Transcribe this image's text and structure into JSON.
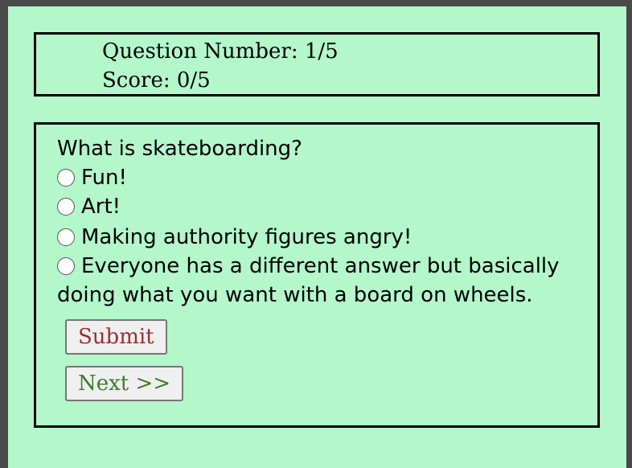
{
  "scoreboard": {
    "question_number": "Question Number: 1/5",
    "score": "Score: 0/5"
  },
  "quiz": {
    "question": "What is skateboarding?",
    "options": [
      {
        "label": "Fun!"
      },
      {
        "label": "Art!"
      },
      {
        "label": "Making authority figures angry!"
      },
      {
        "label": "Everyone has a different answer but basically doing what you want with a board on wheels."
      }
    ],
    "submit_label": "Submit",
    "next_label": "Next >>"
  },
  "colors": {
    "background": "#b3f7cb",
    "submit_text": "#9b2f2f",
    "next_text": "#3b7d2a"
  }
}
